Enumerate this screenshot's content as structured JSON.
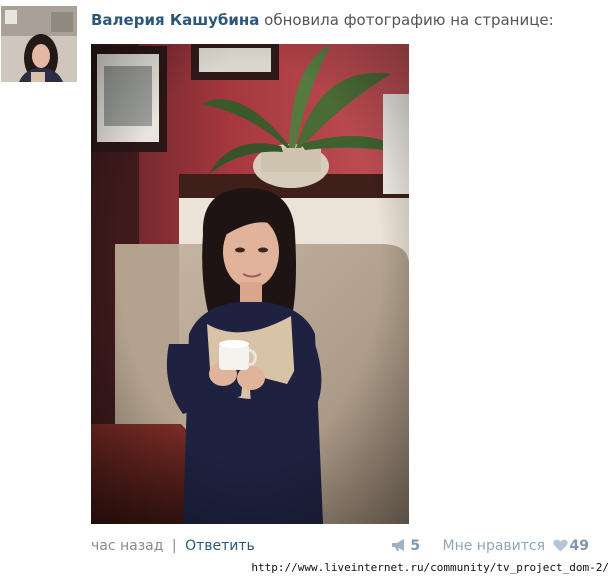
{
  "post": {
    "author": "Валерия Кашубина",
    "action": "обновила фотографию на странице:",
    "avatar_icon": "user-avatar-photo",
    "photo_icon": "woman-with-cup-photo"
  },
  "footer": {
    "time": "час назад",
    "separator": "|",
    "reply_label": "Ответить",
    "share_icon": "megaphone-icon",
    "share_count": "5",
    "like_label": "Мне нравится",
    "like_icon": "heart-icon",
    "like_count": "49"
  },
  "watermark": {
    "url": "http://www.liveinternet.ru/community/tv_project_dom-2/"
  },
  "colors": {
    "link": "#2b587a",
    "muted": "#8a8a8a",
    "counter": "#7e97b0"
  }
}
